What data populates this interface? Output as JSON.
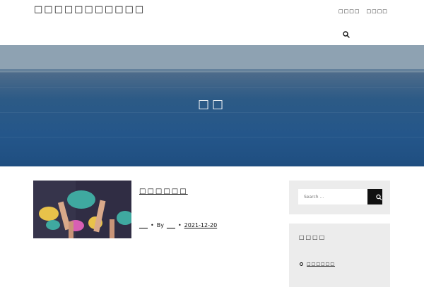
{
  "site": {
    "title": "□□□□□□□□□□□"
  },
  "nav": {
    "items": [
      "□□□□",
      "□□□□"
    ]
  },
  "hero": {
    "title": "□□"
  },
  "post": {
    "title": "□□□□□□",
    "category": "___",
    "by_label": "By",
    "author": "___",
    "date": "2021-12-20"
  },
  "sidebar": {
    "search_placeholder": "Search ...",
    "recent_title": "□□□□",
    "recent_items": [
      "□□□□□□"
    ]
  },
  "colors": {
    "widget_bg": "#ececec",
    "button_bg": "#111111",
    "hero_sea": "#24568a"
  },
  "icons": {
    "search": "search-icon"
  }
}
